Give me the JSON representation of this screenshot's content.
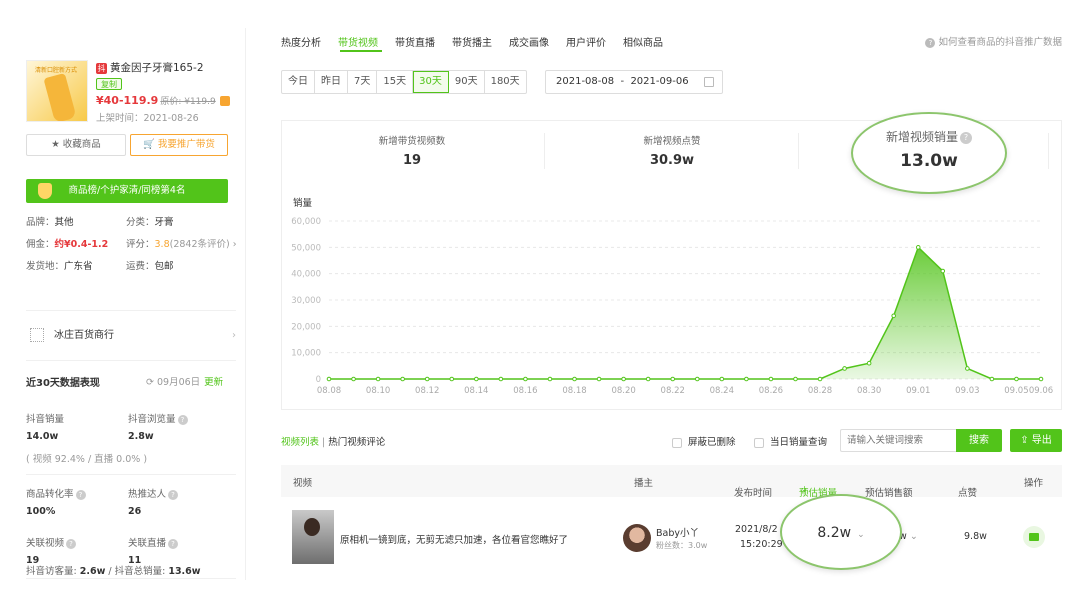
{
  "product": {
    "title": "黄金因子牙膏165-2",
    "copy_tag": "复制",
    "price": "¥40-119.9",
    "orig_price": "原价: ¥119.9",
    "shelf_time": "上架时间：2021-08-26",
    "thumb_caption": "清新口腔新方式",
    "collect_btn": "收藏商品",
    "promote_btn": "我要推广带货",
    "rank": "商品榜/个护家清/同榜第4名"
  },
  "info": {
    "brand_label": "品牌：",
    "brand": "其他",
    "category_label": "分类：",
    "category": "牙膏",
    "commission_label": "佣金：",
    "commission": "约¥0.4-1.2",
    "rating_label": "评分：",
    "rating": "3.8",
    "rating_count": "(2842条评价)",
    "ship_from_label": "发货地：",
    "ship_from": "广东省",
    "shipping_label": "运费：",
    "shipping": "包邮"
  },
  "shop": {
    "name": "冰庄百货商行",
    "logo_text": "冰庄百货"
  },
  "perf": {
    "title": "近30天数据表现",
    "date": "09月06日",
    "update": "更新",
    "sales_label": "抖音销量",
    "sales": "14.0w",
    "views_label": "抖音浏览量",
    "views": "2.8w",
    "share_line": "( 视频 92.4% / 直播 0.0% )",
    "conv_label": "商品转化率",
    "conv": "100%",
    "kol_label": "热推达人",
    "kol": "26",
    "videos_label": "关联视频",
    "videos": "19",
    "lives_label": "关联直播",
    "lives": "11",
    "visitors_label": "抖音访客量:",
    "visitors": "2.6w",
    "total_label": "抖音总销量:",
    "total": "13.6w"
  },
  "tabs": [
    "热度分析",
    "带货视频",
    "带货直播",
    "带货播主",
    "成交画像",
    "用户评价",
    "相似商品"
  ],
  "help_link": "如何查看商品的抖音推广数据",
  "day_options": [
    "今日",
    "昨日",
    "7天",
    "15天",
    "30天",
    "90天",
    "180天"
  ],
  "date_range": "2021-08-08  -  2021-09-06",
  "summary": {
    "new_videos_label": "新增带货视频数",
    "new_videos": "19",
    "new_likes_label": "新增视频点赞",
    "new_likes": "30.9w",
    "new_sales_label": "新增视频销量",
    "new_sales": "13.0w"
  },
  "chart_data": {
    "type": "area",
    "title": "销量",
    "xlabel": "",
    "ylabel": "",
    "ylim": [
      0,
      60000
    ],
    "yticks": [
      0,
      10000,
      20000,
      30000,
      40000,
      50000,
      60000
    ],
    "ytick_labels": [
      "0",
      "10,000",
      "20,000",
      "30,000",
      "40,000",
      "50,000",
      "60,000"
    ],
    "xtick_labels": [
      "08.08",
      "08.10",
      "08.12",
      "08.14",
      "08.16",
      "08.18",
      "08.20",
      "08.22",
      "08.24",
      "08.26",
      "08.28",
      "08.30",
      "09.01",
      "09.03",
      "09.05",
      "09.06"
    ],
    "x": [
      "08.08",
      "08.09",
      "08.10",
      "08.11",
      "08.12",
      "08.13",
      "08.14",
      "08.15",
      "08.16",
      "08.17",
      "08.18",
      "08.19",
      "08.20",
      "08.21",
      "08.22",
      "08.23",
      "08.24",
      "08.25",
      "08.26",
      "08.27",
      "08.28",
      "08.29",
      "08.30",
      "08.31",
      "09.01",
      "09.02",
      "09.03",
      "09.04",
      "09.05",
      "09.06"
    ],
    "values": [
      0,
      0,
      0,
      0,
      0,
      0,
      0,
      0,
      0,
      0,
      0,
      0,
      0,
      0,
      0,
      0,
      0,
      0,
      0,
      0,
      0,
      4000,
      6000,
      24000,
      50000,
      41000,
      4000,
      0,
      0,
      0
    ],
    "grid": true,
    "color": "#52c41a"
  },
  "list": {
    "tab_videos": "视频列表",
    "tab_comments": "热门视频评论",
    "hide_deleted": "屏蔽已删除",
    "today_query": "当日销量查询",
    "search_placeholder": "请输入关键词搜索",
    "search_btn": "搜索",
    "export_btn": "导出",
    "cols": {
      "video": "视频",
      "anchor": "播主",
      "pub_time": "发布时间",
      "est_sales": "预估销量",
      "est_amount": "预估销售额",
      "likes": "点赞",
      "op": "操作"
    },
    "row": {
      "title": "原相机一镜到底，无剪无滤只加速，各位看官您瞧好了",
      "anchor": "Baby小丫",
      "fans": "粉丝数：3.0w",
      "pub_date": "2021/8/2",
      "pub_time": "15:20:29",
      "est_sales": "8.2w",
      "amount_tail": "w",
      "likes": "9.8w"
    }
  }
}
